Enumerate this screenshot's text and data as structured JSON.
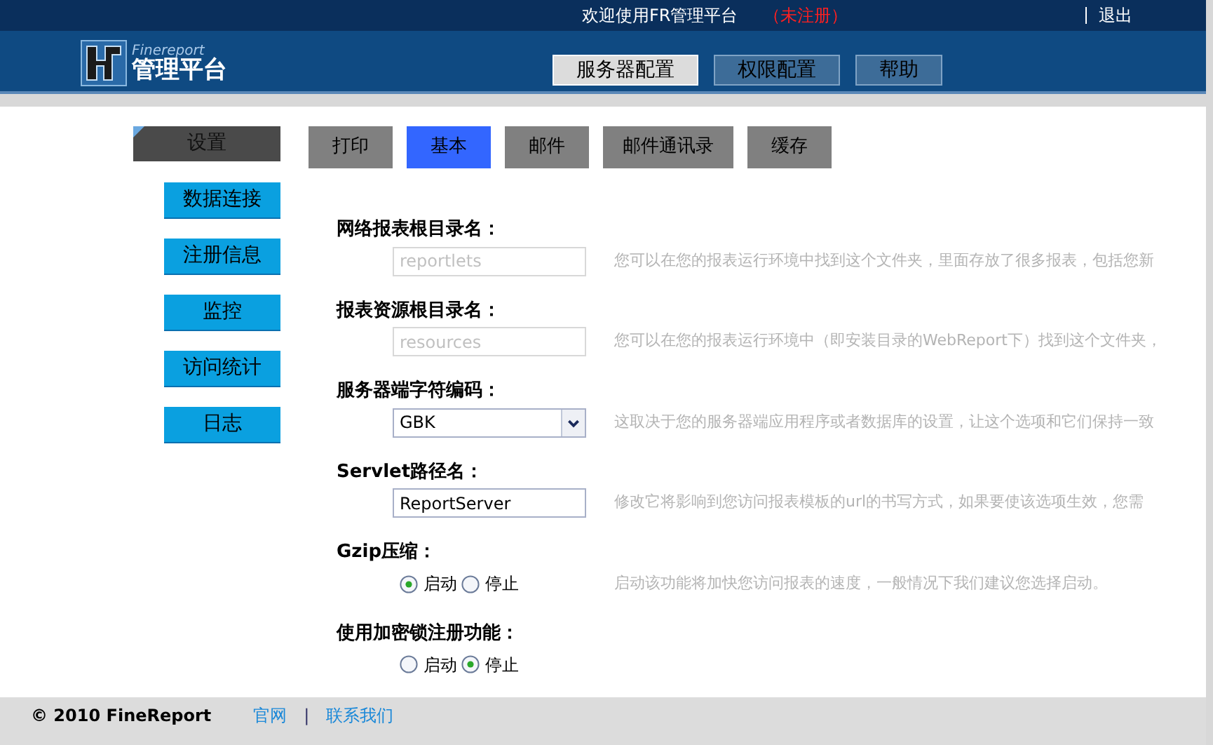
{
  "top_bar": {
    "welcome": "欢迎使用FR管理平台",
    "registration": "（未注册）",
    "logout": "退出"
  },
  "logo": {
    "brand": "Finereport",
    "title": "管理平台"
  },
  "main_tabs": [
    {
      "label": "服务器配置",
      "selected": true
    },
    {
      "label": "权限配置",
      "selected": false
    },
    {
      "label": "帮助",
      "selected": false
    }
  ],
  "sidebar": {
    "header": "设置",
    "items": [
      {
        "label": "数据连接"
      },
      {
        "label": "注册信息"
      },
      {
        "label": "监控"
      },
      {
        "label": "访问统计"
      },
      {
        "label": "日志"
      }
    ]
  },
  "sub_tabs": [
    {
      "label": "打印",
      "selected": false
    },
    {
      "label": "基本",
      "selected": true
    },
    {
      "label": "邮件",
      "selected": false
    },
    {
      "label": "邮件通讯录",
      "selected": false
    },
    {
      "label": "缓存",
      "selected": false
    }
  ],
  "settings": [
    {
      "kind": "text",
      "label": "网络报表根目录名：",
      "placeholder": "reportlets",
      "disabled": true,
      "description": "您可以在您的报表运行环境中找到这个文件夹，里面存放了很多报表，包括您新"
    },
    {
      "kind": "text",
      "label": "报表资源根目录名：",
      "placeholder": "resources",
      "disabled": true,
      "description": "您可以在您的报表运行环境中（即安装目录的WebReport下）找到这个文件夹，"
    },
    {
      "kind": "select",
      "label": "服务器端字符编码：",
      "value": "GBK",
      "description": "这取决于您的服务器端应用程序或者数据库的设置，让这个选项和它们保持一致"
    },
    {
      "kind": "text",
      "label": "Servlet路径名：",
      "value": "ReportServer",
      "disabled": false,
      "description": "修改它将影响到您访问报表模板的url的书写方式，如果要使该选项生效，您需"
    },
    {
      "kind": "radio",
      "label": "Gzip压缩：",
      "options": [
        {
          "label": "启动",
          "selected": true
        },
        {
          "label": "停止",
          "selected": false
        }
      ],
      "description": "启动该功能将加快您访问报表的速度，一般情况下我们建议您选择启动。"
    },
    {
      "kind": "radio",
      "label": "使用加密锁注册功能：",
      "options": [
        {
          "label": "启动",
          "selected": false
        },
        {
          "label": "停止",
          "selected": true
        }
      ]
    }
  ],
  "footer": {
    "copyright": "© 2010 FineReport",
    "links": [
      "官网",
      "联系我们"
    ],
    "separator": "|"
  }
}
